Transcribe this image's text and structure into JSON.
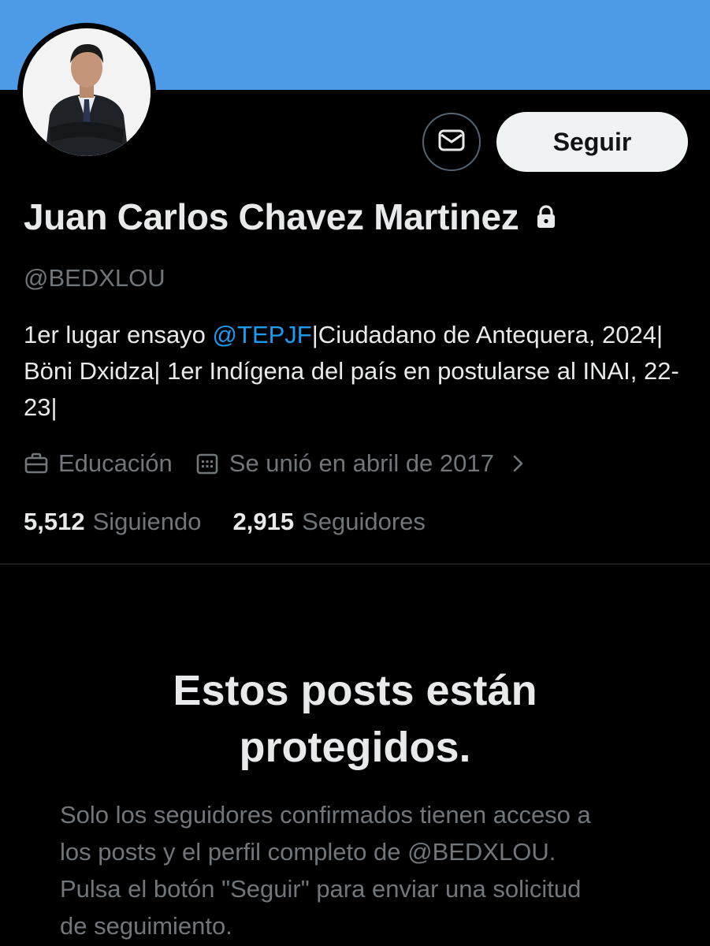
{
  "profile": {
    "name": "Juan Carlos Chavez Martinez",
    "handle": "@BEDXLOU",
    "bio_before": "1er lugar ensayo ",
    "bio_mention": "@TEPJF",
    "bio_after": "|Ciudadano de Antequera, 2024| Böni Dxidza| 1er Indígena del país en postularse al INAI, 22-23|",
    "category": "Educación",
    "joined": "Se unió en abril de 2017",
    "following_count": "5,512",
    "following_label": "Siguiendo",
    "followers_count": "2,915",
    "followers_label": "Seguidores"
  },
  "actions": {
    "follow_label": "Seguir"
  },
  "protected": {
    "title": "Estos posts están protegidos.",
    "body": "Solo los seguidores confirmados tienen acceso a los posts y el perfil completo de @BEDXLOU. Pulsa el botón \"Seguir\" para enviar una solicitud de seguimiento."
  },
  "colors": {
    "banner": "#4d9be6",
    "background": "#000000",
    "text_primary": "#e7e9ea",
    "text_secondary": "#71767b",
    "link": "#1d9bf0"
  },
  "icons": [
    "mail-icon",
    "lock-icon",
    "briefcase-icon",
    "calendar-icon",
    "chevron-right-icon"
  ]
}
